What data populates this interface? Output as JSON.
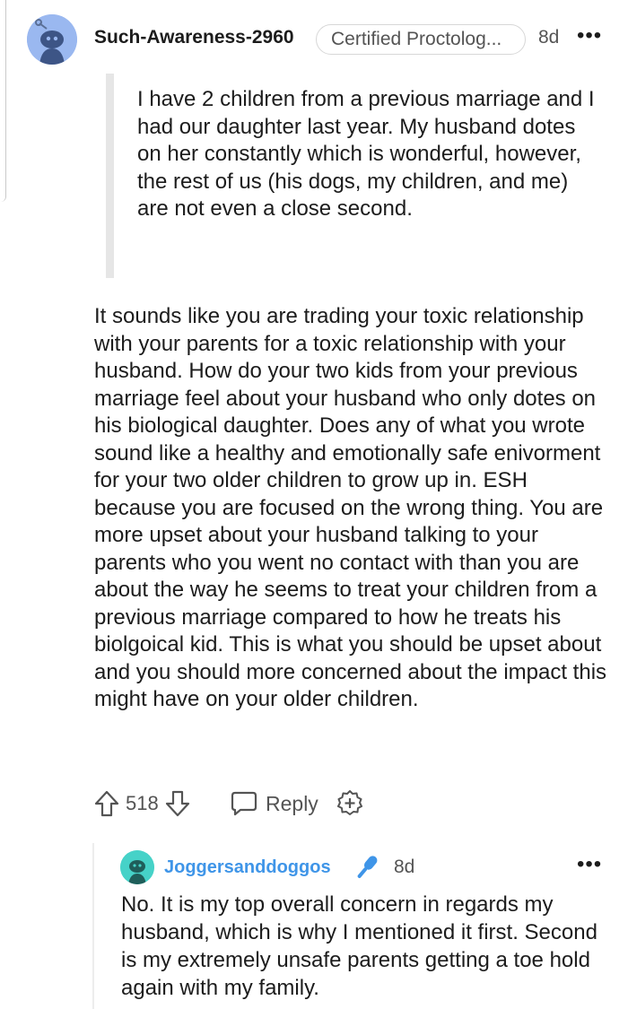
{
  "comment": {
    "username": "Such-Awareness-2960",
    "flair": "Certified Proctolog...",
    "age": "8d",
    "more_glyph": "•••",
    "quote": "I have 2 children from a previous marriage and I had our daughter last year. My husband dotes on her constantly which is wonderful, however, the rest of us (his dogs, my children, and me) are not even a close second.",
    "body": "It sounds like you are trading your toxic relationship with your parents for a toxic relationship with your husband. How do your two kids from your previous marriage feel about your husband who only dotes on his biological daughter. Does any of what you wrote sound like a healthy and emotionally safe enivorment for your two older children to grow up in. ESH because you are focused on the wrong thing. You are more upset about your husband talking to your parents who you went no contact with than you are about the way he seems to treat your children from a previous marriage compared to how he treats his biolgoical kid. This is what you should be upset about and you should more concerned about the impact this might have on your older children.",
    "score": "518",
    "reply_label": "Reply",
    "icons": [
      "snoo-avatar-icon",
      "upvote-icon",
      "downvote-icon",
      "reply-bubble-icon",
      "award-add-icon",
      "more-icon"
    ]
  },
  "reply": {
    "username": "Joggersanddoggos",
    "age": "8d",
    "more_glyph": "•••",
    "body": "No. It is my top overall concern in regards my husband, which is why I mentioned it first. Second is my extremely unsafe parents getting a toe hold again with my family.",
    "icons": [
      "snoo-avatar-icon",
      "op-microphone-icon",
      "more-icon"
    ]
  },
  "colors": {
    "text": "#1c1c1c",
    "meta": "#545454",
    "link_blue": "#3f95e8",
    "avatar_blue": "#9ab8f0",
    "avatar_teal": "#46d2c8",
    "quote_bar": "#e6e6e6"
  }
}
